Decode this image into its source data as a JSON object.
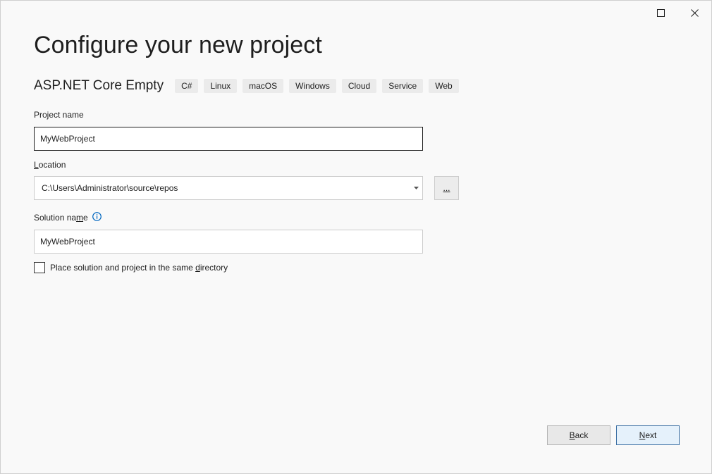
{
  "window": {
    "controls": {
      "maximize_icon": "maximize-icon",
      "close_icon": "close-icon"
    }
  },
  "page": {
    "title": "Configure your new project",
    "template_name": "ASP.NET Core Empty",
    "tags": [
      "C#",
      "Linux",
      "macOS",
      "Windows",
      "Cloud",
      "Service",
      "Web"
    ]
  },
  "project_name": {
    "label": "Project name",
    "value": "MyWebProject"
  },
  "location": {
    "label_mnemonic": "L",
    "label_rest": "ocation",
    "value": "C:\\Users\\Administrator\\source\\repos",
    "browse_label": "..."
  },
  "solution_name": {
    "label_prefix": "Solution na",
    "label_mnemonic": "m",
    "label_suffix": "e",
    "value": "MyWebProject",
    "info_icon": "info-icon"
  },
  "same_directory": {
    "label_prefix": "Place solution and project in the same ",
    "label_mnemonic": "d",
    "label_suffix": "irectory",
    "checked": false
  },
  "buttons": {
    "back_mnemonic": "B",
    "back_rest": "ack",
    "next_mnemonic": "N",
    "next_rest": "ext"
  },
  "colors": {
    "background": "#f9f9f9",
    "info_accent": "#0067c0",
    "next_border": "#3c6fa3",
    "next_background": "#e5f1fb"
  }
}
